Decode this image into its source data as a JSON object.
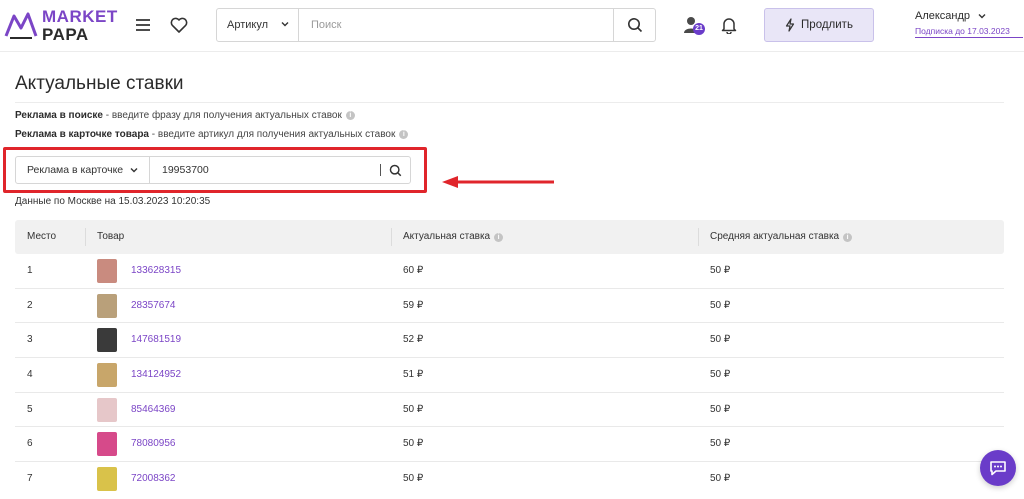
{
  "header": {
    "logo_top": "MARKET",
    "logo_bottom": "PAPA",
    "search_scope": "Артикул",
    "search_placeholder": "Поиск",
    "notifications_count": "21",
    "extend_label": "Продлить",
    "user_name": "Александр",
    "subscription": "Подписка до 17.03.2023"
  },
  "page": {
    "title": "Актуальные ставки",
    "hint_search_bold": "Реклама в поиске",
    "hint_search_text": " - введите фразу для получения актуальных ставок",
    "hint_card_bold": "Реклама в карточке товара",
    "hint_card_text": " - введите артикул для получения актуальных ставок",
    "ad_type": "Реклама в карточке",
    "article_value": "19953700",
    "data_note": "Данные по Москве на 15.03.2023 10:20:35"
  },
  "table": {
    "headers": {
      "place": "Место",
      "product": "Товар",
      "bid": "Актуальная ставка",
      "avg_bid": "Средняя актуальная ставка"
    },
    "rows": [
      {
        "place": "1",
        "sku": "133628315",
        "bid": "60 ₽",
        "avg": "50 ₽",
        "thumb_color": "#c98b7f"
      },
      {
        "place": "2",
        "sku": "28357674",
        "bid": "59 ₽",
        "avg": "50 ₽",
        "thumb_color": "#b9a07a"
      },
      {
        "place": "3",
        "sku": "147681519",
        "bid": "52 ₽",
        "avg": "50 ₽",
        "thumb_color": "#3a3a3a"
      },
      {
        "place": "4",
        "sku": "134124952",
        "bid": "51 ₽",
        "avg": "50 ₽",
        "thumb_color": "#c8a66a"
      },
      {
        "place": "5",
        "sku": "85464369",
        "bid": "50 ₽",
        "avg": "50 ₽",
        "thumb_color": "#e6c7c9"
      },
      {
        "place": "6",
        "sku": "78080956",
        "bid": "50 ₽",
        "avg": "50 ₽",
        "thumb_color": "#d64a8a"
      },
      {
        "place": "7",
        "sku": "72008362",
        "bid": "50 ₽",
        "avg": "50 ₽",
        "thumb_color": "#d9c24a"
      }
    ]
  },
  "colors": {
    "accent": "#7b45c6",
    "highlight": "#e0252b"
  }
}
